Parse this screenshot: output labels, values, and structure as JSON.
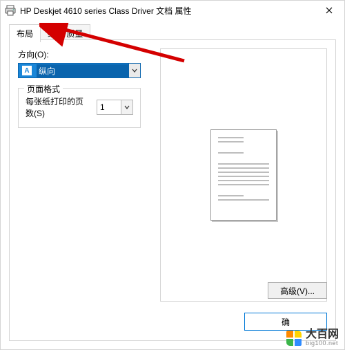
{
  "window": {
    "title": "HP Deskjet 4610 series Class Driver 文档 属性"
  },
  "tabs": {
    "layout": "布局",
    "paper_quality": "纸张/质量"
  },
  "orientation": {
    "label": "方向(O):",
    "value": "纵向",
    "icon_letter": "A"
  },
  "page_format": {
    "group_title": "页面格式",
    "pages_per_sheet_label": "每张纸打印的页数(S)",
    "pages_per_sheet_value": "1"
  },
  "buttons": {
    "advanced": "高级(V)...",
    "ok": "确"
  },
  "watermark": {
    "brand": "大百网",
    "domain": "big100.net"
  }
}
